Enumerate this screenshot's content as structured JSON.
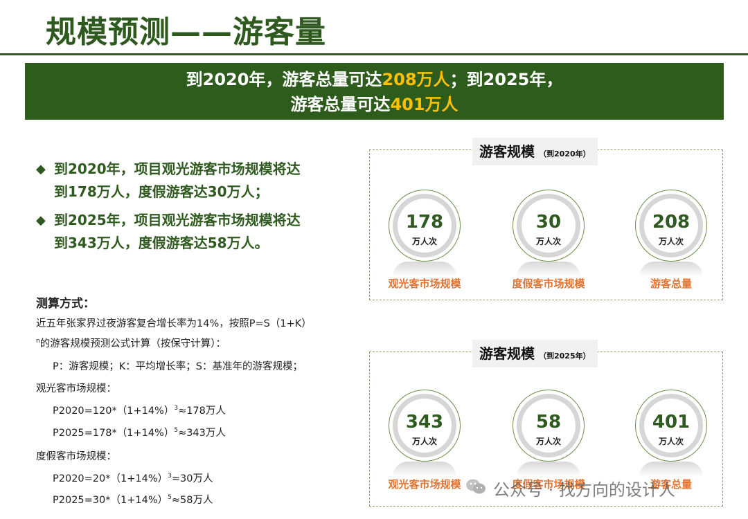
{
  "title": "规模预测——游客量",
  "banner": {
    "line1_a": "到2020年，游客总量可达",
    "line1_hl": "208万人",
    "line1_b": "；到2025年，",
    "line2_a": "游客总量可达",
    "line2_hl": "401万人"
  },
  "bullets": [
    {
      "line1": "到2020年，项目观光游客市场规模将达",
      "line2": "到178万人，度假游客达30万人；"
    },
    {
      "line1": "到2025年，项目观光游客市场规模将达",
      "line2": "到343万人，度假游客达58万人。"
    }
  ],
  "method": {
    "title": "测算方式：",
    "intro1": "近五年张家界过夜游客复合增长率为14%，按照P=S（1+K）",
    "intro2_sup": "n",
    "intro2": "的游客规模预测公式计算（按保守计算）：",
    "legend": "P：游客规模；K：平均增长率；S：基准年的游客规模；",
    "sightseeing_head": "观光客市场规模：",
    "s2020_a": "P2020=120*（1+14%）",
    "s2020_sup": "3",
    "s2020_b": "≈178万人",
    "s2025_a": "P2025=178*（1+14%）",
    "s2025_sup": "5",
    "s2025_b": "≈343万人",
    "resort_head": "度假客市场规模：",
    "r2020_a": "P2020=20*（1+14%）",
    "r2020_sup": "3",
    "r2020_b": "≈30万人",
    "r2025_a": "P2025=30*（1+14%）",
    "r2025_sup": "5",
    "r2025_b": "≈58万人"
  },
  "panel2020": {
    "title": "游客规模",
    "subtitle": "（到2020年）",
    "items": [
      {
        "value": "178",
        "unit": "万人次",
        "label": "观光客市场规模"
      },
      {
        "value": "30",
        "unit": "万人次",
        "label": "度假客市场规模"
      },
      {
        "value": "208",
        "unit": "万人次",
        "label": "游客总量"
      }
    ]
  },
  "panel2025": {
    "title": "游客规模",
    "subtitle": "（到2025年）",
    "items": [
      {
        "value": "343",
        "unit": "万人次",
        "label": "观光客市场规模"
      },
      {
        "value": "58",
        "unit": "万人次",
        "label": "度假客市场规模"
      },
      {
        "value": "401",
        "unit": "万人次",
        "label": "游客总量"
      }
    ]
  },
  "watermark": "公众号 · 找方向的设计人",
  "colors": {
    "primary_green": "#2d5c1d",
    "highlight": "#ffc000",
    "label_orange": "#e27431"
  }
}
